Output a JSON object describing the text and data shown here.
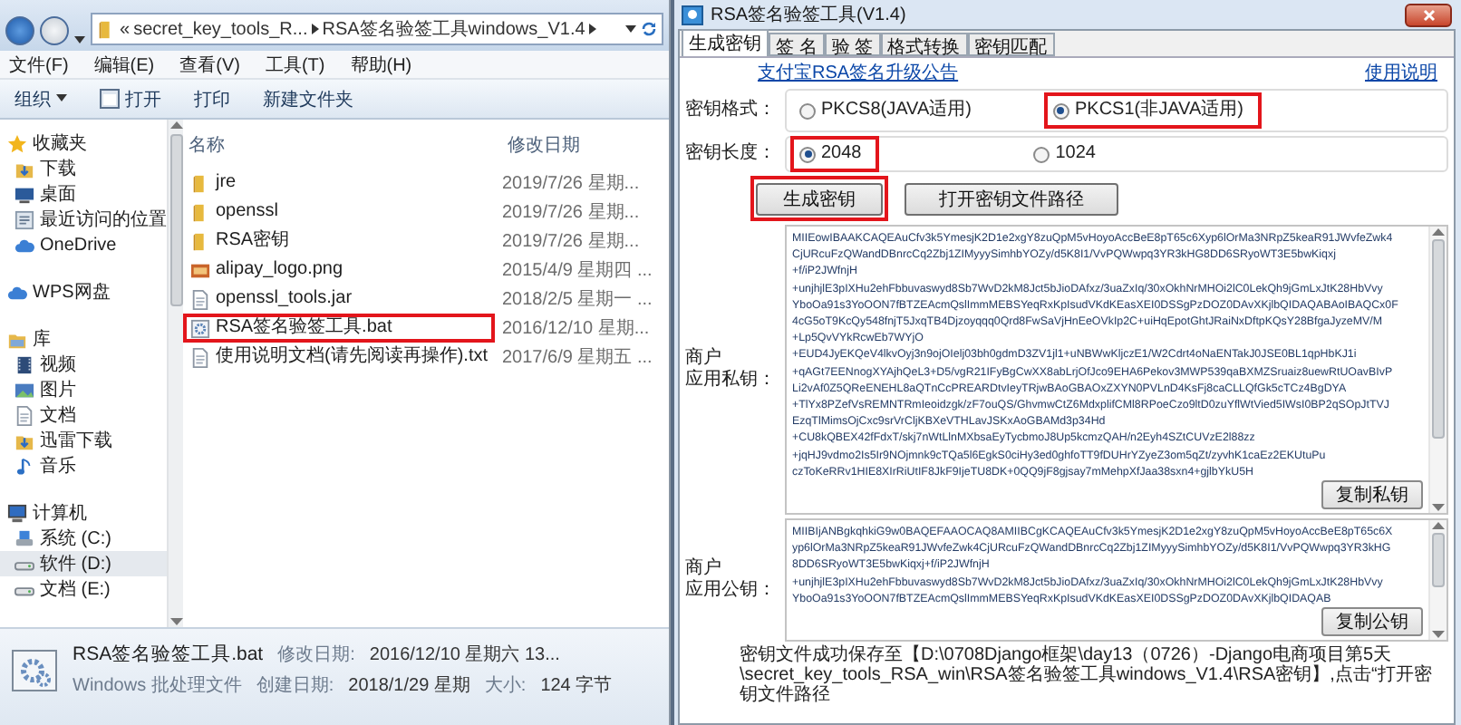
{
  "explorer": {
    "overflow_mark": "«",
    "breadcrumb": [
      "secret_key_tools_R...",
      "RSA签名验签工具windows_V1.4"
    ],
    "menu": [
      "文件(F)",
      "编辑(E)",
      "查看(V)",
      "工具(T)",
      "帮助(H)"
    ],
    "toolbar": [
      {
        "label": "组织",
        "kind": "dropdown"
      },
      {
        "label": "打开",
        "kind": "icon"
      },
      {
        "label": "打印",
        "kind": "plain"
      },
      {
        "label": "新建文件夹",
        "kind": "plain"
      }
    ],
    "nav": [
      {
        "label": "收藏夹",
        "kind": "star",
        "selected": false,
        "children": [
          {
            "label": "下载",
            "kind": "download",
            "selected": false
          },
          {
            "label": "桌面",
            "kind": "desktop",
            "selected": false
          },
          {
            "label": "最近访问的位置",
            "kind": "places",
            "selected": false
          },
          {
            "label": "OneDrive",
            "kind": "cloud",
            "selected": false
          }
        ]
      },
      {
        "label": "WPS网盘",
        "kind": "cloud",
        "selected": false
      },
      {
        "label": "库",
        "kind": "library",
        "selected": false,
        "children": [
          {
            "label": "视频",
            "kind": "video",
            "selected": false
          },
          {
            "label": "图片",
            "kind": "picture",
            "selected": false
          },
          {
            "label": "文档",
            "kind": "document",
            "selected": false
          },
          {
            "label": "迅雷下载",
            "kind": "download",
            "selected": false
          },
          {
            "label": "音乐",
            "kind": "music",
            "selected": false
          }
        ]
      },
      {
        "label": "计算机",
        "kind": "computer",
        "selected": false,
        "children": [
          {
            "label": "系统 (C:)",
            "kind": "system",
            "selected": false
          },
          {
            "label": "软件 (D:)",
            "kind": "drive",
            "selected": true
          },
          {
            "label": "文档 (E:)",
            "kind": "drive",
            "selected": false
          }
        ]
      }
    ],
    "columns": [
      "名称",
      "修改日期"
    ],
    "files": [
      {
        "name": "jre",
        "date": "2019/7/26 星期...",
        "kind": "folder",
        "highlighted": false
      },
      {
        "name": "openssl",
        "date": "2019/7/26 星期...",
        "kind": "folder",
        "highlighted": false
      },
      {
        "name": "RSA密钥",
        "date": "2019/7/26 星期...",
        "kind": "folder",
        "highlighted": false
      },
      {
        "name": "alipay_logo.png",
        "date": "2015/4/9 星期四 ...",
        "kind": "image",
        "highlighted": false
      },
      {
        "name": "openssl_tools.jar",
        "date": "2018/2/5 星期一 ...",
        "kind": "document",
        "highlighted": false
      },
      {
        "name": "RSA签名验签工具.bat",
        "date": "2016/12/10 星期...",
        "kind": "script",
        "highlighted": true
      },
      {
        "name": "使用说明文档(请先阅读再操作).txt",
        "date": "2017/6/9 星期五 ...",
        "kind": "document",
        "highlighted": false
      }
    ],
    "details": {
      "name": "RSA签名验签工具.bat",
      "type": "Windows 批处理文件",
      "fields": [
        {
          "label": "修改日期:",
          "value": "2016/12/10 星期六 13..."
        },
        {
          "label": "创建日期:",
          "value": "2018/1/29 星期"
        },
        {
          "label": "大小:",
          "value": "124 字节"
        }
      ]
    }
  },
  "app": {
    "title": "RSA签名验签工具(V1.4)",
    "tabs": [
      {
        "label": "生成密钥",
        "selected": true
      },
      {
        "label": "签 名",
        "selected": false
      },
      {
        "label": "验 签",
        "selected": false
      },
      {
        "label": "格式转换",
        "selected": false
      },
      {
        "label": "密钥匹配",
        "selected": false
      }
    ],
    "links": [
      "支付宝RSA签名升级公告",
      "使用说明"
    ],
    "key_format": {
      "label": "密钥格式：",
      "options": [
        {
          "label": "PKCS8(JAVA适用)",
          "selected": false,
          "highlighted": false
        },
        {
          "label": "PKCS1(非JAVA适用)",
          "selected": true,
          "highlighted": true
        }
      ]
    },
    "key_length": {
      "label": "密钥长度：",
      "options": [
        {
          "label": "2048",
          "selected": true,
          "highlighted": true
        },
        {
          "label": "1024",
          "selected": false,
          "highlighted": false
        }
      ]
    },
    "buttons": [
      {
        "label": "生成密钥",
        "highlighted": true
      },
      {
        "label": "打开密钥文件路径",
        "highlighted": false
      }
    ],
    "private_key": {
      "label": [
        "商户",
        "应用私钥："
      ],
      "copy_button": "复制私钥",
      "lines": [
        "MIIEowIBAAKCAQEAuCfv3k5YmesjK2D1e2xgY8zuQpM5vHoyoAccBeE8pT65c6Xyp6lOrMa3NRpZ5keaR91JWvfeZwk4",
        "CjURcuFzQWandDBnrcCq2Zbj1ZIMyyySimhbYOZy/d5K8I1/VvPQWwpq3YR3kHG8DD6SRyoWT3E5bwKiqxj",
        "+f/iP2JWfnjH",
        "+unjhjlE3pIXHu2ehFbbuvaswyd8Sb7WvD2kM8Jct5bJioDAfxz/3uaZxIq/30xOkhNrMHOi2lC0LekQh9jGmLxJtK28HbVvy",
        "YboOa91s3YoOON7fBTZEAcmQslImmMEBSYeqRxKpIsudVKdKEasXEI0DSSgPzDOZ0DAvXKjlbQIDAQABAoIBAQCx0F",
        "4cG5oT9KcQy548fnjT5JxqTB4Djzoyqqq0Qrd8FwSaVjHnEeOVkIp2C+uiHqEpotGhtJRaiNxDftpKQsY28BfgaJyzeMV/M",
        "+Lp5QvVYkRcwEb7WYjO",
        "+EUD4JyEKQeV4lkvOyj3n9ojOIelj03bh0gdmD3ZV1jl1+uNBWwKljczE1/W2Cdrt4oNaENTakJ0JSE0BL1qpHbKJ1i",
        "+qAGt7EENnogXYAjhQeL3+D5/vgR21IFyBgCwXX8abLrjOfJco9EHA6Pekov3MWP539qaBXMZSruaiz8uewRtUOavBIvP",
        "Li2vAf0Z5QReENEHL8aQTnCcPREARDtvIeyTRjwBAoGBAOxZXYN0PVLnD4KsFj8caCLLQfGk5cTCz4BgDYA",
        "+TlYx8PZefVsREMNTRmIeoidzgk/zF7ouQS/GhvmwCtZ6MdxplifCMl8RPoeCzo9ltD0zuYflWtVied5IWsI0BP2qSOpJtTVJ",
        "EzqTlMimsOjCxc9srVrCljKBXeVTHLavJSKxAoGBAMd3p34Hd",
        "+CU8kQBEX42fFdxT/skj7nWtLlnMXbsaEyTycbmoJ8Up5kcmzQAH/n2Eyh4SZtCUVzE2l88zz",
        "+jqHJ9vdmo2Is5Ir9NOjmnk9cTQa5l6EgkS0ciHy3ed0ghfoTT9fDUHrYZyeZ3om5qZt/zyvhK1caEz2EKUtuPu",
        "czToKeRRv1HIE8XIrRiUtIF8JkF9IjeTU8DK+0QQ9jF8gjsay7mMehpXfJaa38sxn4+gjlbYkU5H"
      ]
    },
    "public_key": {
      "label": [
        "商户",
        "应用公钥："
      ],
      "copy_button": "复制公钥",
      "lines": [
        "MIIBIjANBgkqhkiG9w0BAQEFAAOCAQ8AMIIBCgKCAQEAuCfv3k5YmesjK2D1e2xgY8zuQpM5vHoyoAccBeE8pT65c6X",
        "yp6lOrMa3NRpZ5keaR91JWvfeZwk4CjURcuFzQWandDBnrcCq2Zbj1ZIMyyySimhbYOZy/d5K8I1/VvPQWwpq3YR3kHG",
        "8DD6SRyoWT3E5bwKiqxj+f/iP2JWfnjH",
        "+unjhjlE3pIXHu2ehFbbuvaswyd8Sb7WvD2kM8Jct5bJioDAfxz/3uaZxIq/30xOkhNrMHOi2lC0LekQh9jGmLxJtK28HbVvy",
        "YboOa91s3YoOON7fBTZEAcmQslImmMEBSYeqRxKpIsudVKdKEasXEI0DSSgPzDOZ0DAvXKjlbQIDAQAB"
      ]
    },
    "status_lines": [
      "密钥文件成功保存至【D:\\0708Django框架\\day13（0726）-Django电商项目第5天",
      "\\secret_key_tools_RSA_win\\RSA签名验签工具windows_V1.4\\RSA密钥】,点击“打开密钥文件路径"
    ]
  }
}
